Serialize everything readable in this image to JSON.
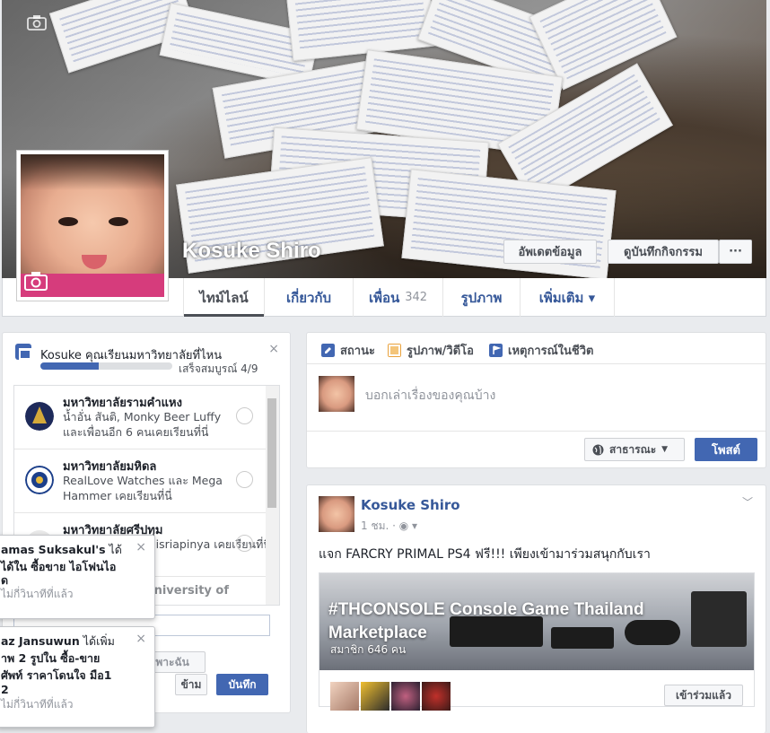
{
  "profile": {
    "name": "Kosuke Shiro",
    "update_info_button": "อัพเดตข้อมูล",
    "activity_log_button": "ดูบันทึกกิจกรรม",
    "more_button": "···"
  },
  "nav": {
    "tabs": [
      {
        "label": "ไทม์ไลน์"
      },
      {
        "label": "เกี่ยวกับ"
      },
      {
        "label": "เพื่อน",
        "count": "342"
      },
      {
        "label": "รูปภาพ"
      },
      {
        "label": "เพิ่มเติม ▾"
      }
    ]
  },
  "education": {
    "question": "Kosuke คุณเรียนมหาวิทยาลัยที่ไหน",
    "progress_text": "เสร็จสมบูรณ์ 4/9",
    "progress_fraction": 0.44,
    "close": "×",
    "universities": [
      {
        "name": "มหาวิทยาลัยรามคำแหง",
        "desc": "น้ำอั่น สันติ, Monky Beer Luffy และเพื่อนอีก 6 คนเคยเรียนที่นี่"
      },
      {
        "name": "มหาวิทยาลัยมหิดล",
        "desc": "RealLove Watches และ Mega Hammer เคยเรียนที่นี่"
      },
      {
        "name": "มหาวิทยาลัยศรีปทุม",
        "desc": "aisriapinya เคยเรียนที่นี่"
      },
      {
        "name": "Assumption University of",
        "desc": ""
      }
    ],
    "only_me": "เฉพาะฉัน",
    "skip_button": "ข้าม",
    "save_button": "บันทึก"
  },
  "notifications": [
    {
      "line1_name": "amas Suksakul's",
      "line1_rest": " ได้",
      "line2": "ได้ใน ซื้อขาย ไอโฟนไอ",
      "line3": "ด",
      "when": "ไม่กี่วินาทีที่แล้ว",
      "close": "×"
    },
    {
      "line1_name": "az Jansuwun",
      "line1_rest": " ได้เพิ่ม",
      "line2": "าพ 2 รูปใน ซื้อ-ขาย",
      "line3": "ศัพท์ ราคาโดนใจ มือ1",
      "line4": "2",
      "when": "ไม่กี่วินาทีที่แล้ว",
      "close": "×"
    }
  ],
  "composer": {
    "tabs": [
      {
        "label": "สถานะ",
        "icon": "pencil-icon"
      },
      {
        "label": "รูปภาพ/วิดีโอ",
        "icon": "photo-icon"
      },
      {
        "label": "เหตุการณ์ในชีวิต",
        "icon": "flag-icon"
      }
    ],
    "placeholder": "บอกเล่าเรื่องของคุณบ้าง",
    "privacy": "สาธารณะ",
    "post_button": "โพสต์"
  },
  "post": {
    "author": "Kosuke Shiro",
    "time": "1 ชม. · ◉ ▾",
    "text": "แจก FARCRY PRIMAL PS4 ฟรี!!! เพียงเข้ามาร่วมสนุกกับเรา",
    "group_title": "#THCONSOLE Console Game Thailand Marketplace",
    "group_members": "สมาชิก 646 คน",
    "join_button": "เข้าร่วมแล้ว"
  },
  "colors": {
    "brand_blue": "#4267b2",
    "link_blue": "#365899"
  }
}
